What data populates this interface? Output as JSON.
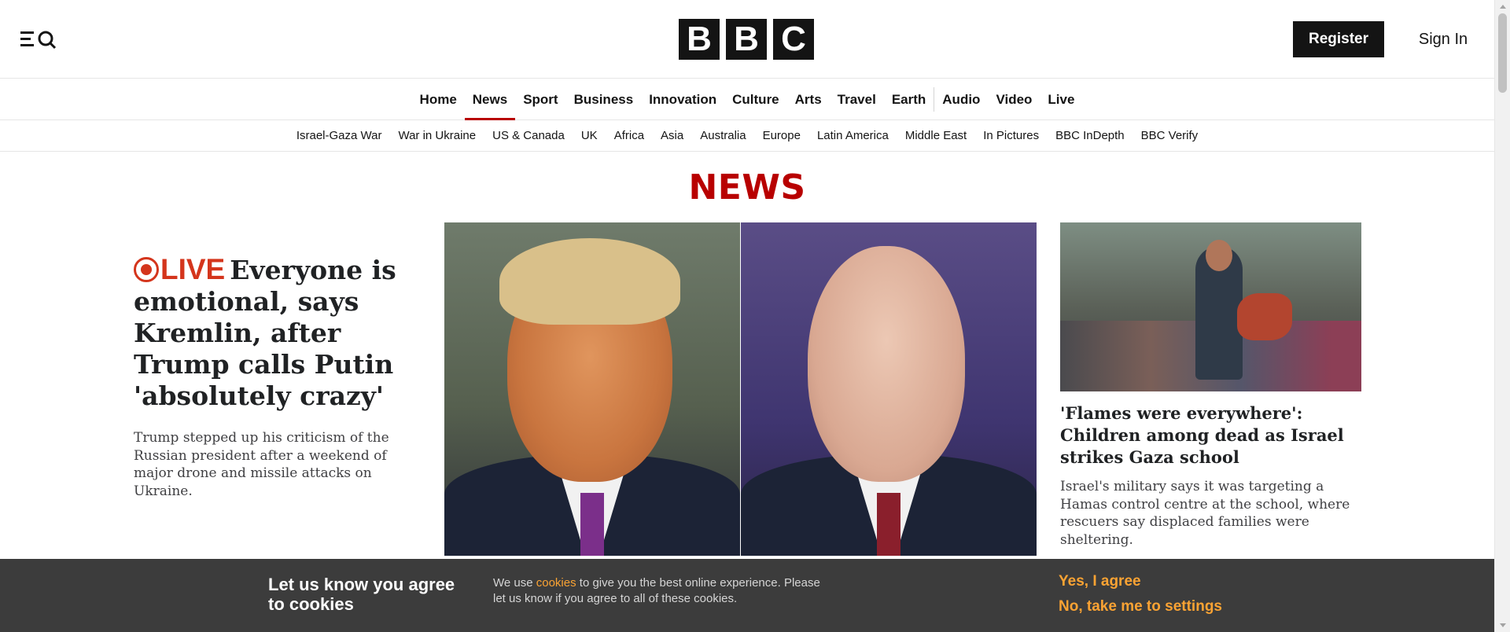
{
  "header": {
    "menu_icon": "menu-search-icon",
    "logo_letters": [
      "B",
      "B",
      "C"
    ],
    "register_label": "Register",
    "signin_label": "Sign In"
  },
  "primary_nav": {
    "items": [
      "Home",
      "News",
      "Sport",
      "Business",
      "Innovation",
      "Culture",
      "Arts",
      "Travel",
      "Earth",
      "Audio",
      "Video",
      "Live"
    ],
    "active": "News"
  },
  "secondary_nav": {
    "items": [
      "Israel-Gaza War",
      "War in Ukraine",
      "US & Canada",
      "UK",
      "Africa",
      "Asia",
      "Australia",
      "Europe",
      "Latin America",
      "Middle East",
      "In Pictures",
      "BBC InDepth",
      "BBC Verify"
    ]
  },
  "section_title": "NEWS",
  "lead_story": {
    "live_label": "LIVE",
    "headline": "Everyone is emotional, says Kremlin, after Trump calls Putin 'absolutely crazy'",
    "summary": "Trump stepped up his criticism of the Russian president after a weekend of major drone and missile attacks on Ukraine."
  },
  "side_story": {
    "headline": "'Flames were everywhere': Children among dead as Israel strikes Gaza school",
    "summary": "Israel's military says it was targeting a Hamas control centre at the school, where rescuers say displaced families were sheltering."
  },
  "cookie_banner": {
    "title": "Let us know you agree to cookies",
    "text_before": "We use ",
    "link": "cookies",
    "text_after": " to give you the best online experience. Please let us know if you agree to all of these cookies.",
    "agree_label": "Yes, I agree",
    "settings_label": "No, take me to settings"
  },
  "colors": {
    "brand_red": "#b80000",
    "live_red": "#d4351c",
    "cookie_accent": "#fba333"
  }
}
